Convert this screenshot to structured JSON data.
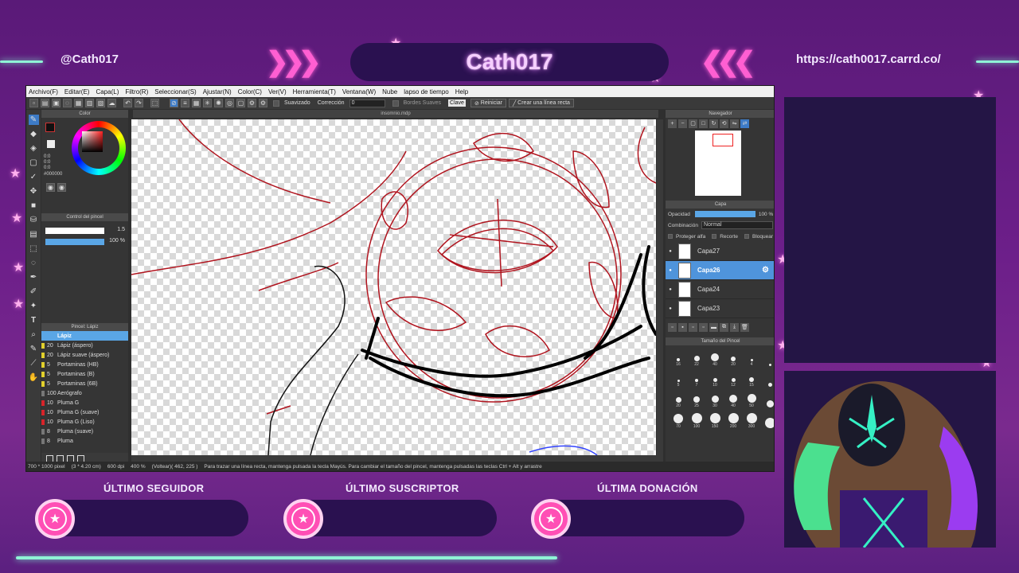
{
  "overlay": {
    "handle": "@Cath017",
    "title": "Cath017",
    "url": "https://cath0017.carrd.co/",
    "alerts": [
      {
        "label": "ÚLTIMO SEGUIDOR"
      },
      {
        "label": "ÚLTIMO SUSCRIPTOR"
      },
      {
        "label": "ÚLTIMA DONACIÓN"
      }
    ]
  },
  "app": {
    "menu": [
      "Archivo(F)",
      "Editar(E)",
      "Capa(L)",
      "Filtro(R)",
      "Seleccionar(S)",
      "Ajustar(N)",
      "Color(C)",
      "Ver(V)",
      "Herramienta(T)",
      "Ventana(W)",
      "Nube",
      "lapso de tiempo",
      "Help"
    ],
    "toolbar": {
      "suavizado": "Suavizado",
      "correccion": "Corrección",
      "correccion_value": "0",
      "bordes": "Bordes Suaves",
      "clave": "Clave",
      "reiniciar": "Reiniciar",
      "linea_recta": "Crear una línea recta"
    },
    "document_tab": "insomnio.mdp",
    "color_panel": {
      "title": "Color",
      "rgb": [
        "0:0",
        "0:0",
        "0:0"
      ],
      "hex": "#000000"
    },
    "brush_control": {
      "title": "Control del pincel",
      "size": "1.5",
      "opacity": "100 %"
    },
    "brush_list": {
      "title": "Pincel: Lápiz",
      "items": [
        {
          "size": "",
          "name": "Lápiz"
        },
        {
          "size": "20",
          "name": "Lápiz (áspero)"
        },
        {
          "size": "20",
          "name": "Lápiz suave (áspero)"
        },
        {
          "size": "5",
          "name": "Portaminas (HB)"
        },
        {
          "size": "5",
          "name": "Portaminas (B)"
        },
        {
          "size": "5",
          "name": "Portaminas (6B)"
        },
        {
          "size": "100",
          "name": "Aerógrafo"
        },
        {
          "size": "10",
          "name": "Pluma G"
        },
        {
          "size": "10",
          "name": "Pluma G (suave)"
        },
        {
          "size": "10",
          "name": "Pluma G (Liso)"
        },
        {
          "size": "8",
          "name": "Pluma (suave)"
        },
        {
          "size": "8",
          "name": "Pluma"
        }
      ]
    },
    "navigator": {
      "title": "Navegador"
    },
    "layers": {
      "title": "Capa",
      "opacity_label": "Opacidad",
      "opacity_value": "100 %",
      "blend_label": "Combinación",
      "blend_value": "Normal",
      "protect_alpha": "Proteger alfa",
      "clip": "Recorte",
      "lock": "Bloquear",
      "items": [
        "Capa27",
        "Capa26",
        "Capa24",
        "Capa23"
      ],
      "selected": "Capa26"
    },
    "brush_sizes": {
      "title": "Tamaño del Pincel",
      "values": [
        "16",
        "22",
        "40",
        "20",
        "4",
        "",
        "5",
        "7",
        "10",
        "12",
        "15",
        "",
        "20",
        "25",
        "30",
        "40",
        "50",
        "",
        "70",
        "100",
        "150",
        "200",
        "300",
        ""
      ]
    },
    "status": {
      "dims": "700 * 1000 pixel",
      "cm": "(3 * 4.20 cm)",
      "dpi": "600 dpi",
      "zoom": "400 %",
      "coords": "(Voltear)( 462, 225 )",
      "hint": "Para trazar una línea recta, mantenga pulsada la tecla Mayús. Para cambiar el tamaño del pincel, mantenga pulsadas las teclas Ctrl + Alt y arrastre"
    }
  },
  "colors": {
    "accent_pink": "#ff4fb5",
    "glow_mint": "#8ff3d6",
    "selection_blue": "#4f94db",
    "sketch_red": "#b0141e"
  }
}
